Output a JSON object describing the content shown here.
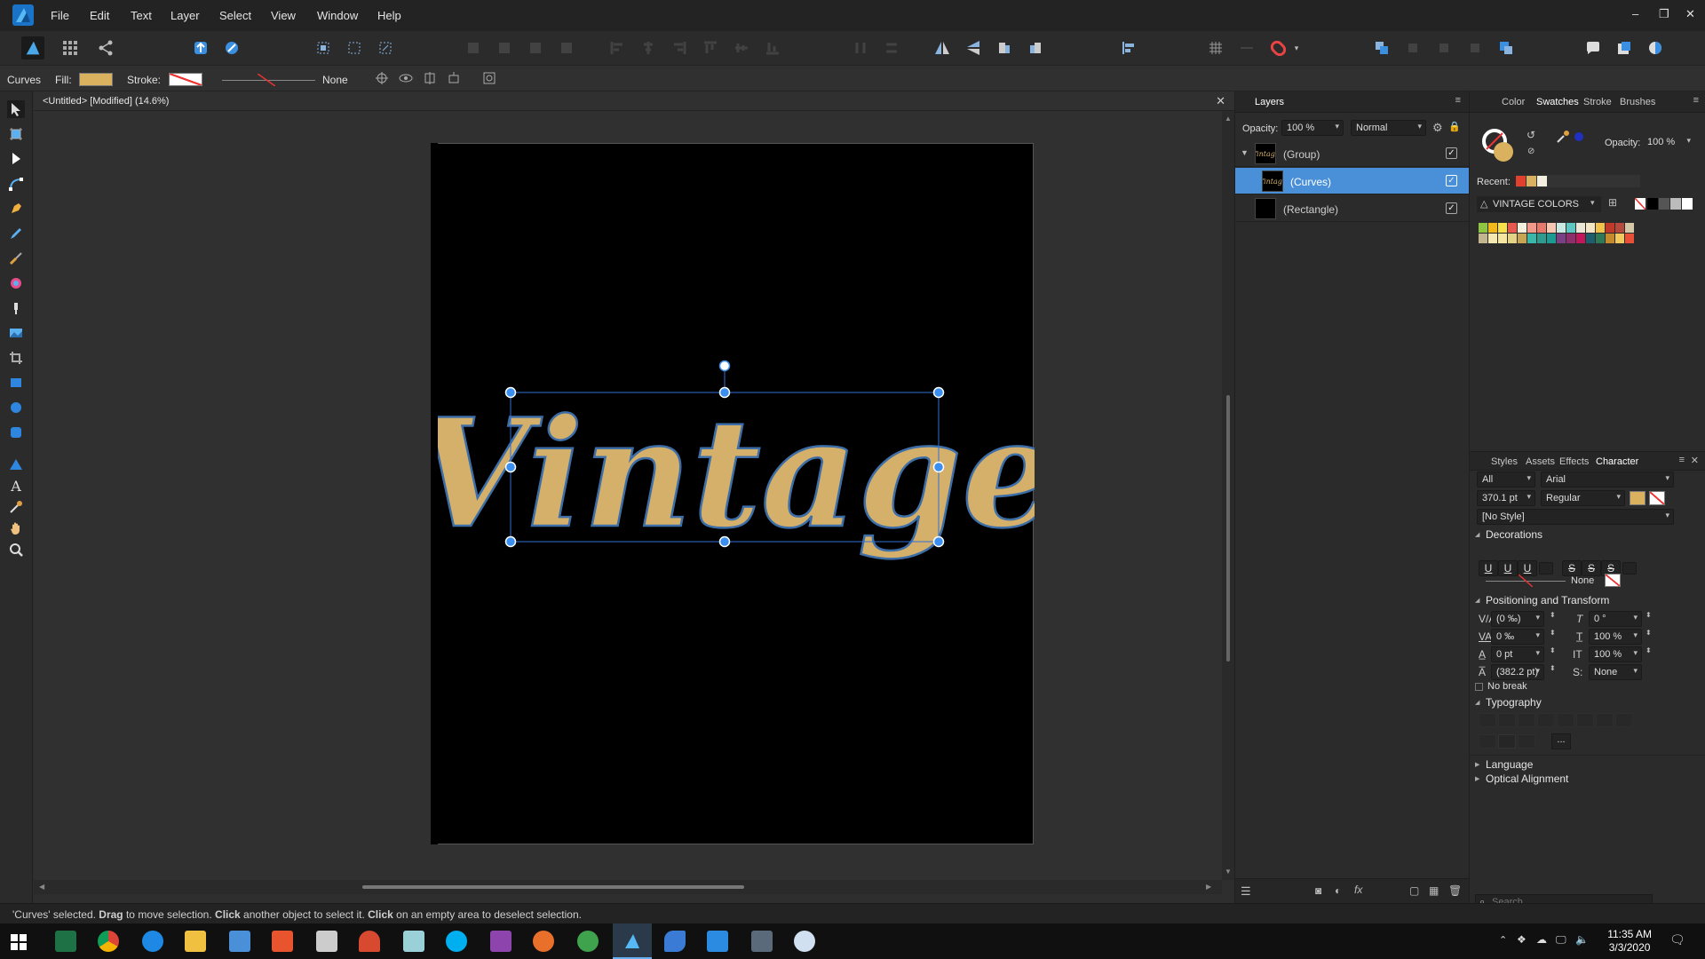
{
  "menu": {
    "items": [
      "File",
      "Edit",
      "Text",
      "Layer",
      "Select",
      "View",
      "Window",
      "Help"
    ]
  },
  "window": {
    "minimize": "–",
    "restore": "❐",
    "close": "✕"
  },
  "context": {
    "tool_name": "Curves",
    "fill_label": "Fill:",
    "stroke_label": "Stroke:",
    "stroke_style": "None",
    "fill_color": "#d9b15f"
  },
  "document": {
    "title": "<Untitled> [Modified] (14.6%)",
    "close": "✕",
    "artwork_text": "Vintage",
    "text_color": "#d4b06a",
    "text_outline": "#3d6ea8"
  },
  "layers": {
    "tab": "Layers",
    "opacity_label": "Opacity:",
    "opacity": "100 %",
    "blend_mode": "Normal",
    "rows": [
      {
        "name": "(Group)",
        "selected": false
      },
      {
        "name": "(Curves)",
        "selected": true
      },
      {
        "name": "(Rectangle)",
        "selected": false
      }
    ]
  },
  "swatches": {
    "tabs": [
      "Color",
      "Swatches",
      "Stroke",
      "Brushes"
    ],
    "active_tab": "Swatches",
    "opacity_label": "Opacity:",
    "opacity": "100 %",
    "recent_label": "Recent:",
    "palette_name": "VINTAGE COLORS",
    "recent_colors": [
      "#e0412e",
      "#d9b15f",
      "#f3efe0"
    ],
    "palette_colors": [
      "#8ec63f",
      "#f1b91b",
      "#f7e14a",
      "#e85a4f",
      "#f4f0dc",
      "#f29a8a",
      "#e87a6b",
      "#f6c7b3",
      "#c9e9e2",
      "#5fc6c1",
      "#e9e6d6",
      "#f3e6c6",
      "#f3c24b",
      "#c0392b",
      "#b64a3c",
      "#d5c8a6",
      "#c2b590",
      "#f4e9b3",
      "#f6e7a0",
      "#e4d287",
      "#c8a552",
      "#3cb6a8",
      "#2d9c8e",
      "#1f9a92",
      "#7b3f86",
      "#8c2f6b",
      "#c2185b",
      "#1e5d6b",
      "#2e7a56",
      "#c68a2e",
      "#f2c95b",
      "#e94f37"
    ],
    "gray_colors": [
      "#000000",
      "#555555",
      "#bbbbbb",
      "#ffffff"
    ]
  },
  "character": {
    "tabs": [
      "Styles",
      "Assets",
      "Effects",
      "Character"
    ],
    "active_tab": "Character",
    "scope": "All",
    "font": "Arial",
    "size": "370.1 pt",
    "weight": "Regular",
    "style": "[No Style]",
    "decorations_title": "Decorations",
    "decoration_buttons": [
      "U",
      "U",
      "U",
      "S",
      "S",
      "S"
    ],
    "decoration_line": "None",
    "positioning_title": "Positioning and Transform",
    "kerning": "(0 ‰)",
    "shear": "0 °",
    "tracking": "0 ‰",
    "vscale": "100 %",
    "baseline": "0 pt",
    "hscale": "100 %",
    "leading": "(382.2 pt)",
    "s_label": "S:",
    "s_value": "None",
    "no_break": "No break",
    "typography_title": "Typography",
    "more": "...",
    "language_title": "Language",
    "optical_title": "Optical Alignment"
  },
  "search": {
    "placeholder": "Search"
  },
  "status": {
    "p1": "'Curves' selected. ",
    "b1": "Drag",
    "p2": " to move selection. ",
    "b2": "Click",
    "p3": " another object to select it. ",
    "b3": "Click",
    "p4": " on an empty area to deselect selection."
  },
  "clock": {
    "time": "11:35 AM",
    "date": "3/3/2020"
  }
}
